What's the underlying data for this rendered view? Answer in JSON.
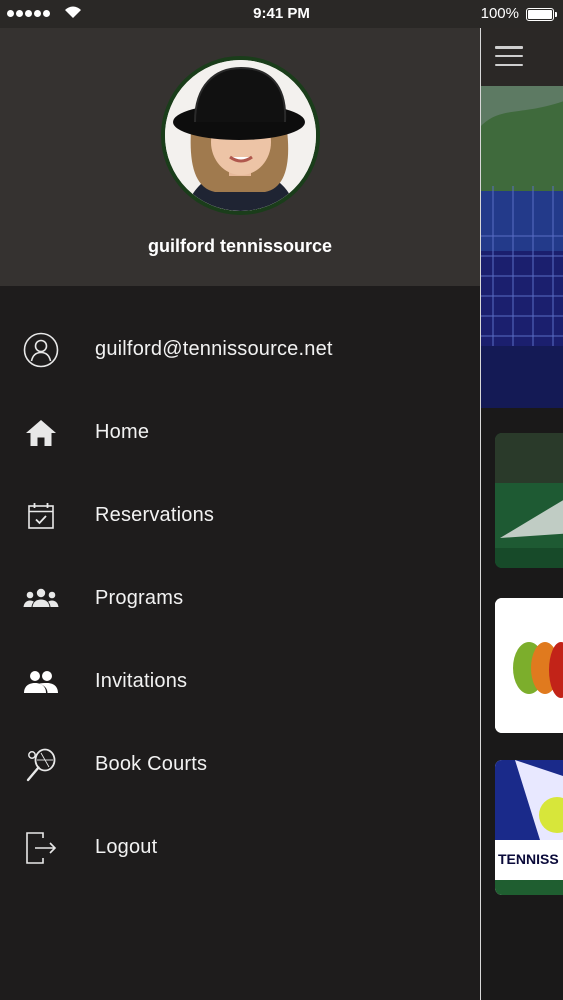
{
  "status_bar": {
    "time": "9:41 PM",
    "battery": "100%",
    "battery_level": 1.0
  },
  "drawer": {
    "user_name": "guilford tennissource",
    "menu": [
      {
        "icon": "account-circle-icon",
        "label": "guilford@tennissource.net"
      },
      {
        "icon": "home-icon",
        "label": "Home"
      },
      {
        "icon": "calendar-check-icon",
        "label": "Reservations"
      },
      {
        "icon": "group-icon",
        "label": "Programs"
      },
      {
        "icon": "people-icon",
        "label": "Invitations"
      },
      {
        "icon": "tennis-racket-icon",
        "label": "Book Courts"
      },
      {
        "icon": "logout-icon",
        "label": "Logout"
      }
    ]
  },
  "main": {
    "card_text": "TENNISS"
  },
  "colors": {
    "drawer_bg": "#1e1c1c",
    "header_bg": "#353230",
    "avatar_ring": "#1a3d1a",
    "divider": "#d8d8d8"
  }
}
